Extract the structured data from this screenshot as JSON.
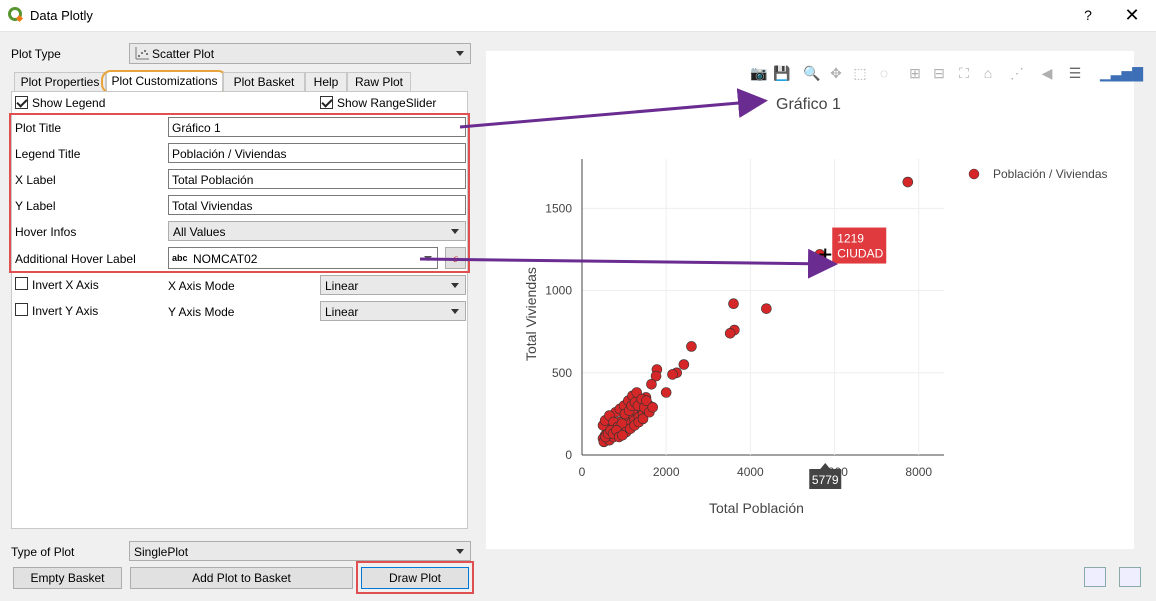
{
  "window": {
    "title": "Data Plotly",
    "help": "?",
    "close": "✕"
  },
  "plot_type": {
    "label": "Plot Type",
    "value": "Scatter Plot"
  },
  "tabs": [
    {
      "label": "Plot Properties"
    },
    {
      "label": "Plot Customizations"
    },
    {
      "label": "Plot Basket"
    },
    {
      "label": "Help"
    },
    {
      "label": "Raw Plot"
    }
  ],
  "options": {
    "show_legend": "Show Legend",
    "show_rangeslider": "Show RangeSlider"
  },
  "fields": {
    "plot_title": {
      "label": "Plot Title",
      "value": "Gráfico 1"
    },
    "legend_title": {
      "label": "Legend Title",
      "value": "Población / Viviendas"
    },
    "x_label": {
      "label": "X Label",
      "value": "Total Población"
    },
    "y_label": {
      "label": "Y Label",
      "value": "Total Viviendas"
    },
    "hover_infos": {
      "label": "Hover Infos",
      "value": "All Values"
    },
    "additional_hover": {
      "label": "Additional Hover Label",
      "value": "NOMCAT02",
      "prefix": "abc"
    }
  },
  "axes": {
    "invert_x": "Invert X Axis",
    "x_mode_label": "X Axis Mode",
    "x_mode": "Linear",
    "invert_y": "Invert Y Axis",
    "y_mode_label": "Y Axis Mode",
    "y_mode": "Linear"
  },
  "type_of_plot": {
    "label": "Type of Plot",
    "value": "SinglePlot"
  },
  "buttons": {
    "empty_basket": "Empty Basket",
    "add_to_basket": "Add Plot to Basket",
    "draw_plot": "Draw Plot"
  },
  "colors": {
    "accent_red": "#e05050",
    "marker": "#d62728",
    "arrow": "#6a2c91",
    "tab_highlight": "#e8a33a"
  },
  "chart_data": {
    "type": "scatter",
    "title": "Gráfico 1",
    "xlabel": "Total Población",
    "ylabel": "Total Viviendas",
    "legend": "Población / Viviendas",
    "legend_position": "top-right",
    "xlim": [
      0,
      8600
    ],
    "ylim": [
      0,
      1800
    ],
    "xticks": [
      "0",
      "2000",
      "4000",
      "6000",
      "8000"
    ],
    "yticks": [
      "0",
      "500",
      "1000",
      "1500"
    ],
    "grid": true,
    "hover": {
      "x": 5779,
      "y": 1219,
      "label_y": "1219",
      "label_name": "CIUDAD",
      "label_x": "5779"
    },
    "points": [
      [
        7740,
        1660
      ],
      [
        5650,
        1220
      ],
      [
        3600,
        920
      ],
      [
        4380,
        890
      ],
      [
        3620,
        760
      ],
      [
        3520,
        740
      ],
      [
        2600,
        660
      ],
      [
        2420,
        550
      ],
      [
        2250,
        500
      ],
      [
        2150,
        490
      ],
      [
        1780,
        520
      ],
      [
        1760,
        480
      ],
      [
        1650,
        430
      ],
      [
        2000,
        380
      ],
      [
        1520,
        350
      ],
      [
        1600,
        300
      ],
      [
        1400,
        320
      ],
      [
        1300,
        290
      ],
      [
        1200,
        260
      ],
      [
        1100,
        240
      ],
      [
        1000,
        220
      ],
      [
        900,
        200
      ],
      [
        800,
        180
      ],
      [
        700,
        160
      ],
      [
        600,
        140
      ],
      [
        550,
        120
      ],
      [
        500,
        100
      ],
      [
        520,
        80
      ],
      [
        650,
        90
      ],
      [
        750,
        110
      ],
      [
        850,
        130
      ],
      [
        950,
        150
      ],
      [
        1050,
        170
      ],
      [
        1150,
        190
      ],
      [
        1250,
        210
      ],
      [
        1350,
        230
      ],
      [
        1450,
        250
      ],
      [
        1550,
        270
      ],
      [
        700,
        220
      ],
      [
        600,
        200
      ],
      [
        800,
        260
      ],
      [
        900,
        280
      ],
      [
        1000,
        300
      ],
      [
        1100,
        330
      ],
      [
        1200,
        360
      ],
      [
        1300,
        380
      ],
      [
        500,
        180
      ],
      [
        550,
        210
      ],
      [
        650,
        240
      ],
      [
        750,
        200
      ],
      [
        850,
        170
      ],
      [
        950,
        190
      ],
      [
        1050,
        140
      ],
      [
        1150,
        160
      ],
      [
        1250,
        180
      ],
      [
        1350,
        200
      ],
      [
        1450,
        220
      ],
      [
        560,
        110
      ],
      [
        620,
        130
      ],
      [
        680,
        150
      ],
      [
        740,
        130
      ],
      [
        820,
        150
      ],
      [
        880,
        110
      ],
      [
        960,
        120
      ],
      [
        1020,
        250
      ],
      [
        1120,
        270
      ],
      [
        1180,
        300
      ],
      [
        1260,
        320
      ],
      [
        1330,
        300
      ],
      [
        1420,
        340
      ],
      [
        1480,
        290
      ],
      [
        1530,
        330
      ],
      [
        1600,
        260
      ],
      [
        1680,
        290
      ]
    ]
  }
}
